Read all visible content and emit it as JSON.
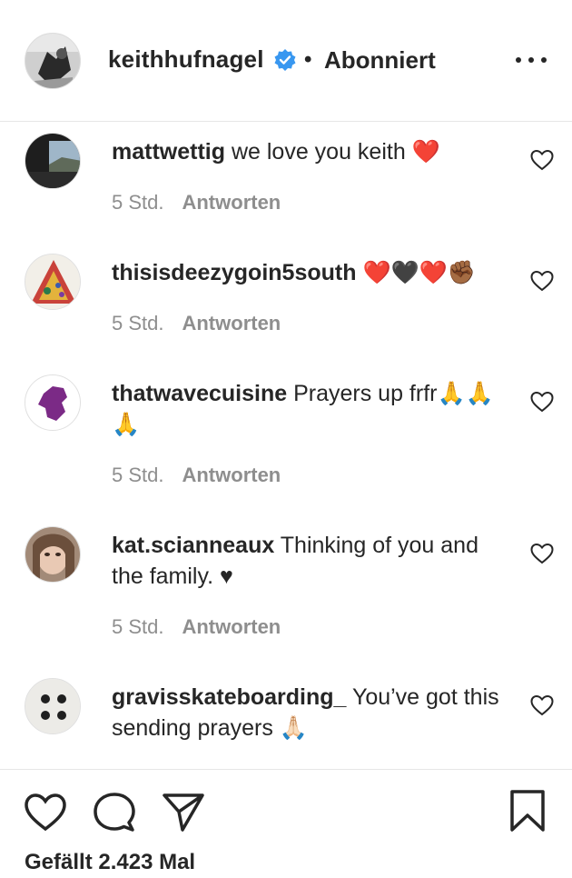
{
  "post": {
    "author": "keithhufnagel",
    "separator": "•",
    "follow_status": "Abonniert",
    "more_icon": "more-horizontal-icon"
  },
  "comments": [
    {
      "user": "mattwettig",
      "text": "we love you keith ❤️",
      "time": "5 Std.",
      "reply": "Antworten"
    },
    {
      "user": "thisisdeezygoin5south",
      "text": "❤️🖤❤️✊🏾",
      "time": "5 Std.",
      "reply": "Antworten"
    },
    {
      "user": "thatwavecuisine",
      "text": "Prayers up frfr🙏🙏🙏",
      "time": "5 Std.",
      "reply": "Antworten"
    },
    {
      "user": "kat.scianneaux",
      "text": "Thinking of you and the family. ♥",
      "time": "5 Std.",
      "reply": "Antworten"
    },
    {
      "user": "gravisskateboarding_",
      "text": "You’ve got this sending prayers 🙏🏻",
      "time": "",
      "reply": ""
    }
  ],
  "footer": {
    "likes_text": "Gefällt 2.423 Mal"
  },
  "colors": {
    "text": "#262626",
    "muted": "#8e8e8e",
    "verified": "#3897f0",
    "divider": "#e6e6e6"
  }
}
